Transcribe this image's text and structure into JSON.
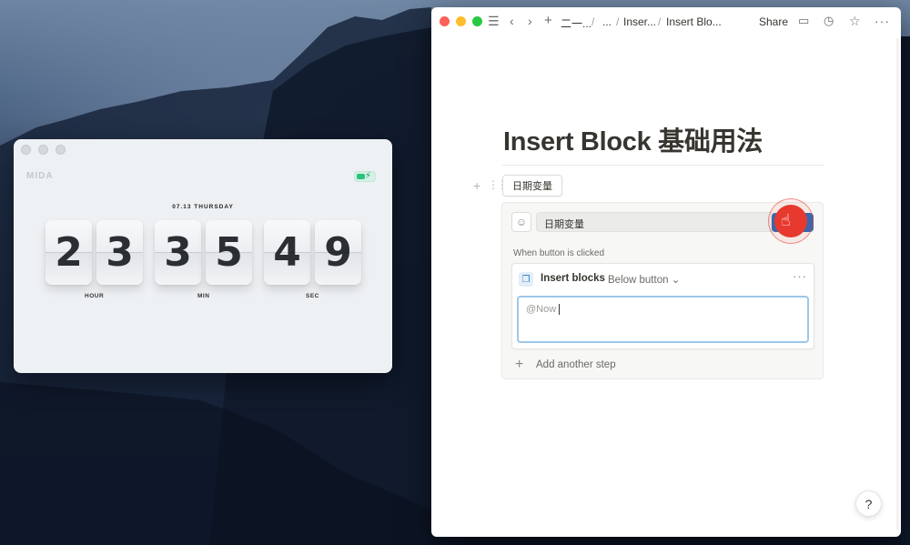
{
  "clock": {
    "date_label": "07.13 THURSDAY",
    "digits": [
      "2",
      "3",
      "3",
      "5",
      "4",
      "9"
    ],
    "labels": {
      "hour": "HOUR",
      "min": "MIN",
      "sec": "SEC"
    },
    "logo": "MIDA"
  },
  "notion": {
    "breadcrumbs": [
      "二一...",
      "...",
      "Inser...",
      "Insert Blo..."
    ],
    "share_label": "Share",
    "page_title": "Insert Block 基础用法",
    "button_block_label": "日期变量",
    "button_name_value": "日期变量",
    "when_clicked_label": "When button is clicked",
    "step": {
      "title": "Insert blocks",
      "position": "Below button",
      "content": "@Now"
    },
    "add_step_label": "Add another step",
    "help_label": "?",
    "accent_color": "#2e6bb5",
    "click_indicator_color": "#e8392f"
  }
}
